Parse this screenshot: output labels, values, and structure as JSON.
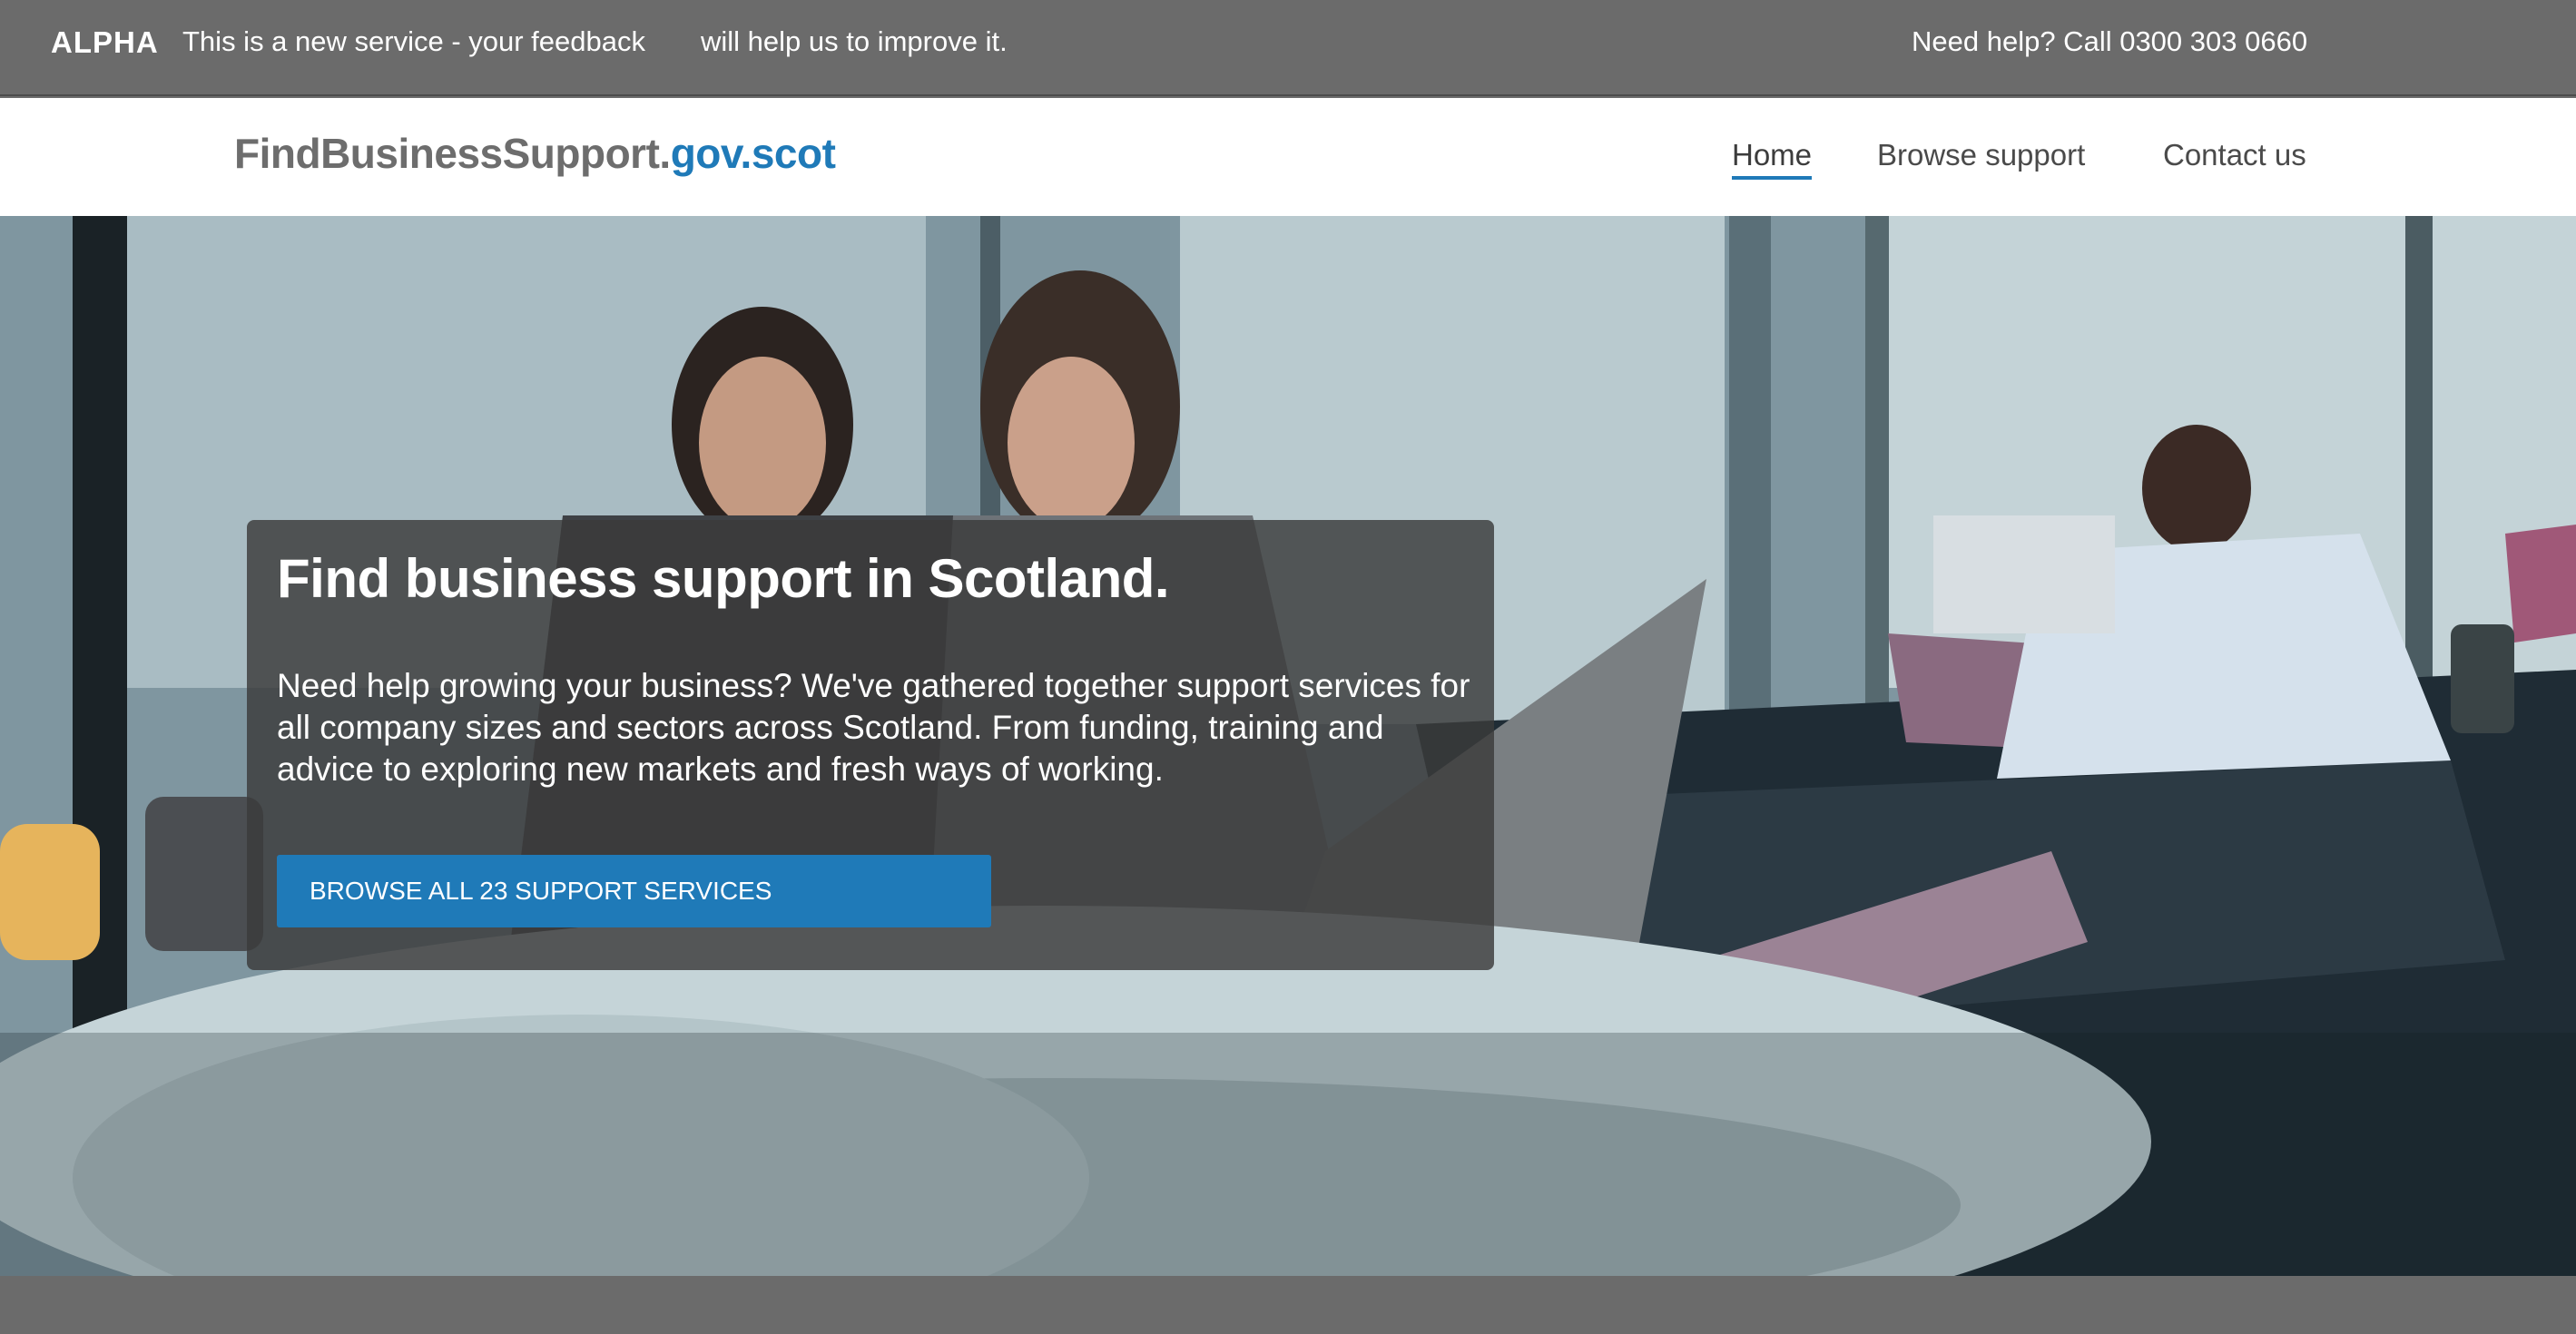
{
  "alpha_banner": {
    "tag": "ALPHA",
    "message_part1": "This is a new service - your feedback",
    "message_part2": "will help us to improve it.",
    "help": "Need help? Call 0300 303 0660"
  },
  "header": {
    "logo_main": "FindBusinessSupport.",
    "logo_domain": "gov.scot",
    "nav": [
      {
        "label": "Home",
        "active": true
      },
      {
        "label": "Browse support",
        "active": false
      },
      {
        "label": "Contact us",
        "active": false
      }
    ]
  },
  "hero": {
    "title": "Find business support in Scotland.",
    "description": "Need help growing your business? We've gathered together support services for all company sizes and sectors across Scotland. From funding, training and advice to exploring new markets and fresh ways of working.",
    "button_label": "BROWSE ALL 23 SUPPORT SERVICES",
    "background_image": "office-people-photo"
  },
  "colors": {
    "brand_blue": "#1f7ab8",
    "banner_grey": "#6b6b6b",
    "card_overlay": "#3a3a3a"
  }
}
